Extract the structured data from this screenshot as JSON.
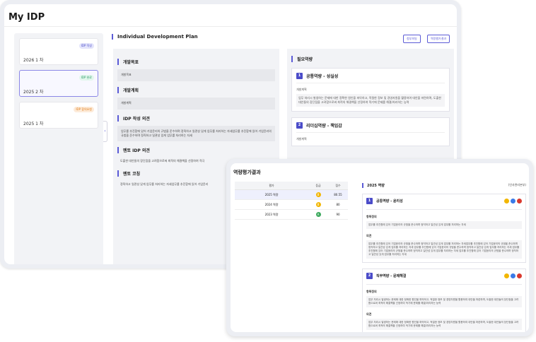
{
  "app": {
    "title": "My IDP"
  },
  "idp_list": [
    {
      "year_label": "2026 1 차",
      "badge": "IDP 작성",
      "badge_class": "b-blue"
    },
    {
      "year_label": "2025 2 차",
      "badge": "IDP 완료",
      "badge_class": "b-green",
      "selected": true
    },
    {
      "year_label": "2025 1 차",
      "badge": "IDP 합의요청",
      "badge_class": "b-orange"
    }
  ],
  "main": {
    "title": "Individual Development Plan",
    "buttons": {
      "attachments": "첨부파일",
      "competency_result": "역량평가결과"
    },
    "sections": {
      "goal": {
        "heading": "개발목표",
        "text": "개발목표"
      },
      "plan": {
        "heading": "개발계획",
        "text": "개발계획"
      },
      "writer_opinion": {
        "heading": "IDP 작성 의견",
        "text": "업무를 추진함에 있어 기업윤리의 규범을 준수하며 정직하고 일관성 있게 업무를 처리하는 자세업무를 추진함에 있어 기업윤리의 규범을 준수하며 정직하고 일관성 있게 업무를 처리하는 자세"
      },
      "mentor_opinion": {
        "heading": "멘토 IDP 의견",
        "text": "도출한 대안들의 장단점을 고려함으로써 최적의 해결책을 선정하여 적극"
      },
      "mentor_coaching": {
        "heading": "멘토 코칭",
        "text": "정직하고 일관성 있게 업무를 처리하는 자세업무를 추진함에 있어 기업윤리"
      }
    }
  },
  "required": {
    "heading": "필요역량",
    "items": [
      {
        "num": "1",
        "title": "공통역량 - 성실성",
        "label": "개발계획",
        "text": "업무 처리시 발생하는 문제에 대한 정확한 원인을 파악하고, 적절한 정보 및 경영자원을 활용하여 대안을 마련하며, 도출한 대안들의 장단점을 고려함으로써 최적의 해결책을 선정하여 적기에 문제를 해결/처리하는 능력"
      },
      {
        "num": "2",
        "title": "리더십역량 - 책임감",
        "label": "개발계획"
      }
    ]
  },
  "front": {
    "title": "역량평가결과",
    "table": {
      "headers": [
        "평가",
        "등급",
        "점수"
      ],
      "rows": [
        {
          "eval": "2025 역량",
          "grade": "B",
          "score": "80.55",
          "color": "#f2b600",
          "selected": true
        },
        {
          "eval": "2024 역량",
          "grade": "B",
          "score": "80",
          "color": "#f2b600"
        },
        {
          "eval": "2023 역량",
          "grade": "A",
          "score": "90",
          "color": "#3aa85c"
        }
      ]
    },
    "detail": {
      "heading": "2025 역량",
      "dept": "(인사관리본부)",
      "cards": [
        {
          "num": "1",
          "title": "공통역량 - 윤리성",
          "dots": [
            "#f2b600",
            "#3b7be8",
            "#d9392e"
          ],
          "def_label": "항목정의",
          "def_text": "업무를 추진함에 있어 기업윤리의 규범을 준수하며 정직하고 일관성 있게 업무를 처리하는 자세",
          "op_label": "의견",
          "op_text": "업무를 추진함에 있어 기업윤리의 규범을 준수하며 정직하고 일관성 있게 업무를 처리하는 자세업무를 추진함에 있어 기업윤리의 규범을 준수하며 정직하고 일관성 있게 업무를 처리하는 자세 업무를 추진함에 있어 기업윤리의 규범을 준수하며 정직하고 일관성 있게 업무를 처리하는 자세 업무를 추진함에 있어 기업윤리의 규범을 준수하며 정직하고 일관성 있게 업무를 처리하는 자세 업무를 추진함에 있어 기업윤리의 규범을 준수하며 정직하고 일관성 있게 업무를 처리하는 자세"
        },
        {
          "num": "2",
          "title": "직무역량 - 문제해결",
          "dots": [
            "#f2b600",
            "#3b7be8",
            "#d9392e"
          ],
          "def_label": "항목정의",
          "def_text": "업무 처리시 발생하는 문제에 대한 정확한 원인을 파악하고, 적절한 정보 및 경영자원을 활용하여 대안을 마련하며, 도출한 대안들의 장단점을 고려함으로써 최적의 해결책을 선정하여 적기에 문제를 해결/처리하는 능력",
          "op_label": "의견",
          "op_text": "업무 처리시 발생하는 문제에 대한 정확한 원인을 파악하고, 적절한 정보 및 경영자원을 활용하여 대안을 마련하며, 도출한 대안들의 장단점을 고려함으로써 최적의 해결책을 선정하여 적기에 문제를 해결/처리하는 능력"
        }
      ]
    }
  }
}
